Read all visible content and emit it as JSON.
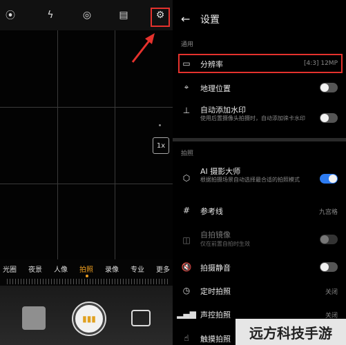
{
  "camera": {
    "zoom_label": "1x",
    "modes": [
      "光圈",
      "夜景",
      "人像",
      "拍照",
      "录像",
      "专业",
      "更多"
    ],
    "active_mode_index": 3
  },
  "settings": {
    "title": "设置",
    "section_general": "通用",
    "section_photo": "拍照",
    "rows": {
      "resolution": {
        "label": "分辨率",
        "value": "[4:3] 12MP"
      },
      "location": {
        "label": "地理位置",
        "on": false
      },
      "watermark": {
        "label": "自动添加水印",
        "sub": "使用后置摄像头拍摄时，自动添加徕卡水印",
        "on": false
      },
      "ai_master": {
        "label": "AI 摄影大师",
        "sub": "根据拍摄场景自动选择最合适的拍照模式",
        "on": true
      },
      "grid": {
        "label": "参考线",
        "value": "九宫格"
      },
      "mirror": {
        "label": "自拍镜像",
        "sub": "仅在前置自拍时生效",
        "on": false
      },
      "mute": {
        "label": "拍摄静音",
        "on": false
      },
      "timer": {
        "label": "定时拍照",
        "value": "关闭"
      },
      "voice": {
        "label": "声控拍照",
        "value": "关闭"
      },
      "touch": {
        "label": "触摸拍照"
      }
    }
  },
  "watermark_text": "远方科技手游",
  "colors": {
    "accent": "#2d7cf2",
    "highlight": "#e5322d",
    "mode_active": "#f0a020"
  }
}
